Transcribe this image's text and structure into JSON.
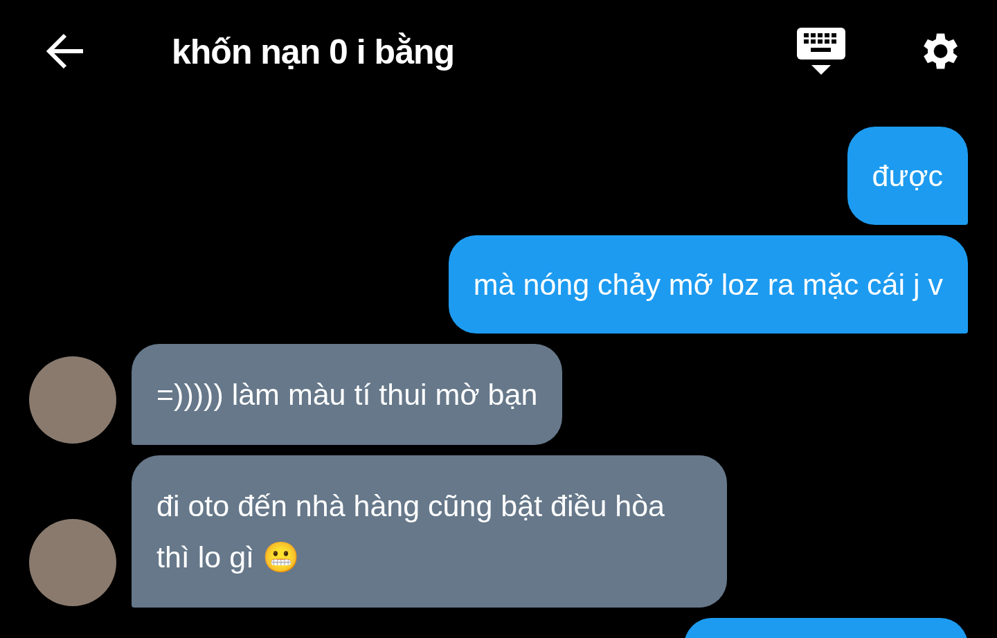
{
  "header": {
    "title": "khốn nạn 0 i bằng"
  },
  "messages": [
    {
      "kind": "me",
      "text": "được"
    },
    {
      "kind": "me",
      "text": "mà nóng chảy mỡ loz ra mặc cái j v"
    },
    {
      "kind": "them",
      "text": "=))))) làm màu tí thui mờ bạn"
    },
    {
      "kind": "them",
      "text": "đi oto đến nhà hàng cũng bật điều hòa thì lo gì 😬"
    },
    {
      "kind": "me"
    }
  ]
}
